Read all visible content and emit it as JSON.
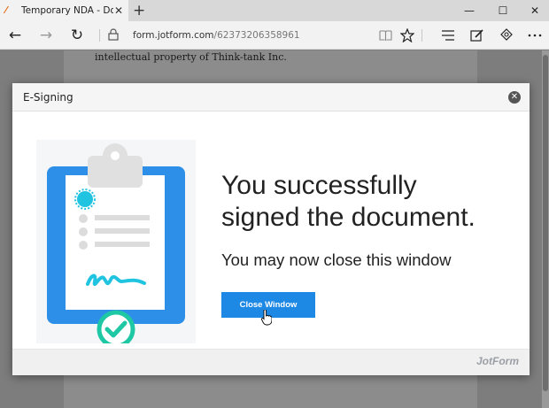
{
  "browser": {
    "tab_title": "Temporary NDA - Docu",
    "tab_close": "✕",
    "new_tab": "+",
    "url_domain": "form.jotform.com",
    "url_path": "/62373206358961",
    "window_controls": {
      "minimize": "—",
      "maximize": "☐",
      "close": "✕"
    },
    "nav": {
      "back": "←",
      "forward": "→",
      "refresh": "↻"
    }
  },
  "page": {
    "background_text": "intellectual property of Think-tank Inc."
  },
  "modal": {
    "title": "E-Signing",
    "close_glyph": "✕",
    "headline_line1": "You successfully",
    "headline_line2": "signed the document.",
    "subtext": "You may now close this window",
    "button_label": "Close Window",
    "brand": "JotForm"
  },
  "colors": {
    "accent": "#1e88e5",
    "clipboard_blue": "#2e8fe8",
    "check_green": "#1ec8a5",
    "seal_teal": "#20c3e0"
  },
  "icons": {
    "tab": "jotform-favicon",
    "lock": "lock-icon",
    "reading_view": "book-icon",
    "favorite": "star-icon",
    "hub": "hub-icon",
    "notes": "pen-icon",
    "share": "share-icon",
    "more": "more-icon"
  }
}
